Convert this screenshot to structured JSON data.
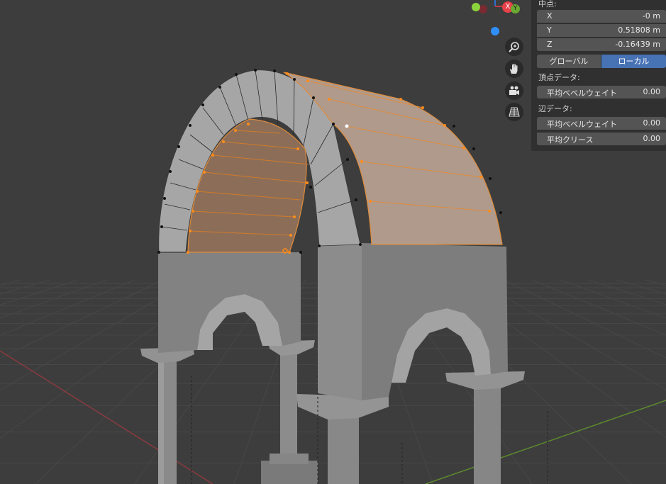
{
  "gizmo": {
    "x_axis_label": "X",
    "y_axis_label": "Y"
  },
  "navigation": [
    {
      "icon": "zoom-icon"
    },
    {
      "icon": "hand-pan-icon"
    },
    {
      "icon": "camera-icon"
    },
    {
      "icon": "perspective-grid-icon"
    }
  ],
  "item_panel": {
    "median_title": "中点:",
    "x_label": "X",
    "x_value": "-0 m",
    "y_label": "Y",
    "y_value": "0.51808 m",
    "z_label": "Z",
    "z_value": "-0.16439 m",
    "global_label": "グローバル",
    "local_label": "ローカル",
    "vertex_data_title": "頂点データ:",
    "vertex_bevel_label": "平均ベベルウェイト",
    "vertex_bevel_value": "0.00",
    "edge_data_title": "辺データ:",
    "edge_bevel_label": "平均ベベルウェイト",
    "edge_bevel_value": "0.00",
    "crease_label": "平均クリース",
    "crease_value": "0.00"
  },
  "colors": {
    "viewport_bg": "#3d3d3d",
    "panel_bg": "#303030",
    "field_bg": "#545454",
    "active_toggle": "#4772b3",
    "selection_orange": "#ff8c1a",
    "x_axis_red": "#e8414a",
    "y_axis_green": "#8bd33c",
    "z_axis_blue": "#2f8ffd"
  }
}
